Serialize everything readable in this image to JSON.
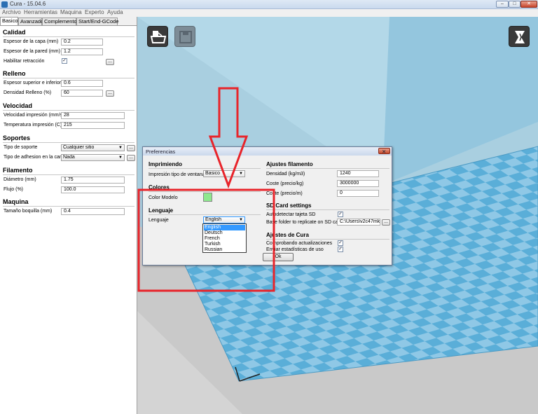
{
  "window": {
    "title": "Cura - 15.04.6",
    "minimize": "–",
    "maximize": "□",
    "close": "✕"
  },
  "menu": [
    "Archivo",
    "Herramientas",
    "Maquina",
    "Experto",
    "Ayuda"
  ],
  "tabs": [
    "Basico",
    "Avanzado",
    "Complementos",
    "Start/End-GCode"
  ],
  "left": {
    "calidad": {
      "title": "Calidad",
      "layer_label": "Espesor de la capa (mm)",
      "layer_value": "0.2",
      "wall_label": "Espesor de la pared (mm)",
      "wall_value": "1.2",
      "retract_label": "Habilitar retracción",
      "retract_checked": true
    },
    "relleno": {
      "title": "Relleno",
      "topbottom_label": "Espesor superior e inferior",
      "topbottom_value": "0.6",
      "density_label": "Densidad Relleno (%)",
      "density_value": "60"
    },
    "velocidad": {
      "title": "Velocidad",
      "speed_label": "Velocidad impresión (mm/s)",
      "speed_value": "28",
      "temp_label": "Temperatura impresión (C)",
      "temp_value": "215"
    },
    "soportes": {
      "title": "Soportes",
      "type_label": "Tipo de soporte",
      "type_value": "Cualquier sitio",
      "adhesion_label": "Tipo de adhesion en la cama",
      "adhesion_value": "Nada"
    },
    "filamento": {
      "title": "Filamento",
      "diameter_label": "Diámetro (mm)",
      "diameter_value": "1.75",
      "flow_label": "Flujo (%)",
      "flow_value": "100.0"
    },
    "maquina": {
      "title": "Maquina",
      "nozzle_label": "Tamaño boquilla (mm)",
      "nozzle_value": "0.4"
    },
    "more_button": "..."
  },
  "dialog": {
    "title": "Preferencias",
    "imprimiendo": {
      "title": "Imprimiendo",
      "window_type_label": "Impresión tipo de ventana",
      "window_type_value": "Basico"
    },
    "colores": {
      "title": "Colores",
      "model_color_label": "Color Modelo",
      "model_color": "#8ee88e"
    },
    "lenguaje": {
      "title": "Lenguaje",
      "language_label": "Lenguaje",
      "language_value": "English",
      "options": [
        "English",
        "Deutsch",
        "French",
        "Turkish",
        "Russian"
      ],
      "selected_index": 0
    },
    "filamento": {
      "title": "Ajustes filamento",
      "density_label": "Densidad (kg/m3)",
      "density_value": "1240",
      "cost_kg_label": "Coste (precio/kg)",
      "cost_kg_value": "3000000",
      "cost_m_label": "Coste (precio/m)",
      "cost_m_value": "0"
    },
    "sdcard": {
      "title": "SD Card settings",
      "autodetect_label": "Autodetectar tajeta SD",
      "autodetect_checked": true,
      "base_folder_label": "Base folder to replicate on SD card",
      "base_folder_value": "C:\\Users\\v2c47mk7"
    },
    "cura": {
      "title": "Ajustes de Cura",
      "updates_label": "Comprobando actualizaciones",
      "updates_checked": true,
      "stats_label": "Enviar estadísticas de uso",
      "stats_checked": true
    },
    "ok_label": "Ok"
  },
  "viewport": {
    "background": "#a9cfe0",
    "tile_light": "#8fc8e6",
    "tile_dark": "#5aaed8"
  },
  "annotation_color": "#e8242a",
  "icons": [
    "load-model-icon",
    "save-gcode-icon",
    "view-mode-icon"
  ]
}
